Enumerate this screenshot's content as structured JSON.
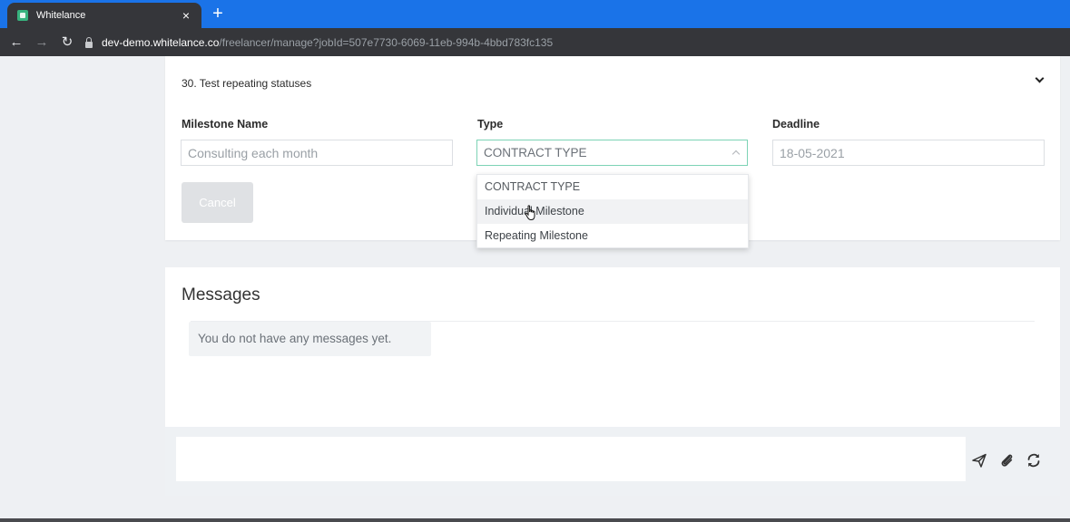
{
  "browser": {
    "tab_title": "Whitelance",
    "tab_close": "×",
    "new_tab": "+",
    "url_host": "dev-demo.whitelance.co",
    "url_path": "/freelancer/manage?jobId=507e7730-6069-11eb-994b-4bbd783fc135",
    "favicon_color": "#37b37e",
    "tabbar_color": "#1a73e8"
  },
  "milestone": {
    "heading": "30. Test repeating statuses",
    "name_label": "Milestone Name",
    "name_value": "Consulting each month",
    "type_label": "Type",
    "type_selected": "CONTRACT TYPE",
    "type_options": [
      "CONTRACT TYPE",
      "Individual Milestone",
      "Repeating Milestone"
    ],
    "type_hovered_option": "Individual Milestone",
    "deadline_label": "Deadline",
    "deadline_value": "18-05-2021",
    "cancel_label": "Cancel"
  },
  "messages": {
    "title": "Messages",
    "empty_text": "You do not have any messages yet.",
    "input_value": "",
    "icons": [
      "send-icon",
      "paperclip-icon",
      "refresh-icon"
    ]
  }
}
